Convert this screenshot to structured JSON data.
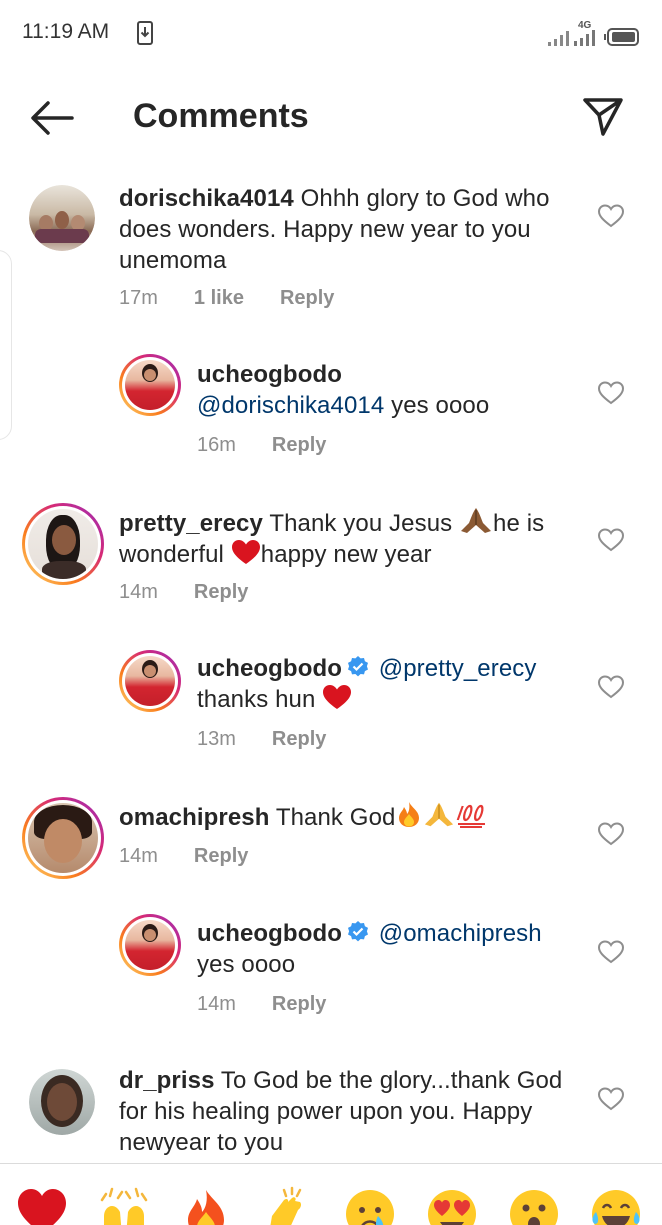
{
  "status_bar": {
    "time": "11:19 AM",
    "network": "4G"
  },
  "header": {
    "title": "Comments"
  },
  "comments": [
    {
      "username": "dorischika4014",
      "text": "Ohhh glory to God who does wonders. Happy new year to you unemoma",
      "time": "17m",
      "likes": "1 like",
      "reply_label": "Reply"
    },
    {
      "username": "ucheogbodo",
      "mention": "@dorischika4014",
      "text": "yes oooo",
      "time": "16m",
      "reply_label": "Reply"
    },
    {
      "username": "pretty_erecy",
      "text_a": "Thank you Jesus",
      "text_b": "he is",
      "text_c": "wonderful",
      "text_d": "happy new year",
      "time": "14m",
      "reply_label": "Reply"
    },
    {
      "username": "ucheogbodo",
      "mention": "@pretty_erecy",
      "text": "thanks hun",
      "time": "13m",
      "reply_label": "Reply"
    },
    {
      "username": "omachipresh",
      "text": "Thank God",
      "time": "14m",
      "reply_label": "Reply"
    },
    {
      "username": "ucheogbodo",
      "mention": "@omachipresh",
      "text": "yes oooo",
      "time": "14m",
      "reply_label": "Reply"
    },
    {
      "username": "dr_priss",
      "text": "To God be the glory...thank God for his healing power upon you.  Happy newyear to you"
    }
  ],
  "emoji_reactions": [
    "red-heart",
    "raising-hands",
    "fire",
    "clapping-hands",
    "crying-face",
    "heart-eyes",
    "astonished-face",
    "tears-of-joy"
  ],
  "colors": {
    "text": "#262626",
    "secondary": "#8e8e8e",
    "mention": "#00376b",
    "verified": "#3897f0",
    "heart": "#e0151f"
  }
}
